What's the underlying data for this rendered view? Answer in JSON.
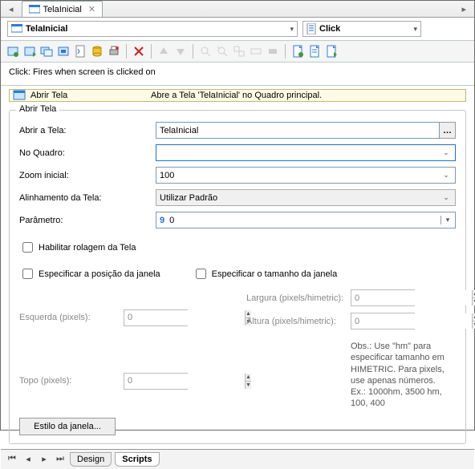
{
  "tab": {
    "title": "TelaInicial"
  },
  "toolbar1": {
    "target": {
      "label": "TelaInicial"
    },
    "event": {
      "label": "Click"
    }
  },
  "description": "Click: Fires when screen is clicked on",
  "action": {
    "name": "Abrir Tela",
    "desc": "Abre a Tela 'TelaInicial' no Quadro principal."
  },
  "group": {
    "legend": "Abrir Tela",
    "labels": {
      "abrir": "Abrir a Tela:",
      "quadro": "No Quadro:",
      "zoom": "Zoom inicial:",
      "alinhamento": "Alinhamento da Tela:",
      "parametro": "Parâmetro:"
    },
    "values": {
      "abrir": "TelaInicial",
      "quadro": "",
      "zoom": "100",
      "alinhamento": "Utilizar Padrão",
      "param_tag": "9",
      "param_val": "0"
    },
    "check": {
      "scroll": "Habilitar rolagem da Tela",
      "pos": "Especificar a posição da janela",
      "size": "Especificar o tamanho da janela"
    },
    "pos": {
      "left": "Esquerda (pixels):",
      "top": "Topo (pixels):",
      "width": "Largura (pixels/himetric):",
      "height": "Altura (pixels/himetric):",
      "left_v": "0",
      "top_v": "0",
      "width_v": "0",
      "height_v": "0"
    },
    "note1": "Obs.: Use \"hm\" para especificar tamanho em",
    "note2": "HIMETRIC. Para pixels, use apenas números.",
    "note3": "Ex.: 1000hm, 3500 hm, 100, 400",
    "stylebtn": "Estilo da janela..."
  },
  "bottom": {
    "design": "Design",
    "scripts": "Scripts"
  }
}
